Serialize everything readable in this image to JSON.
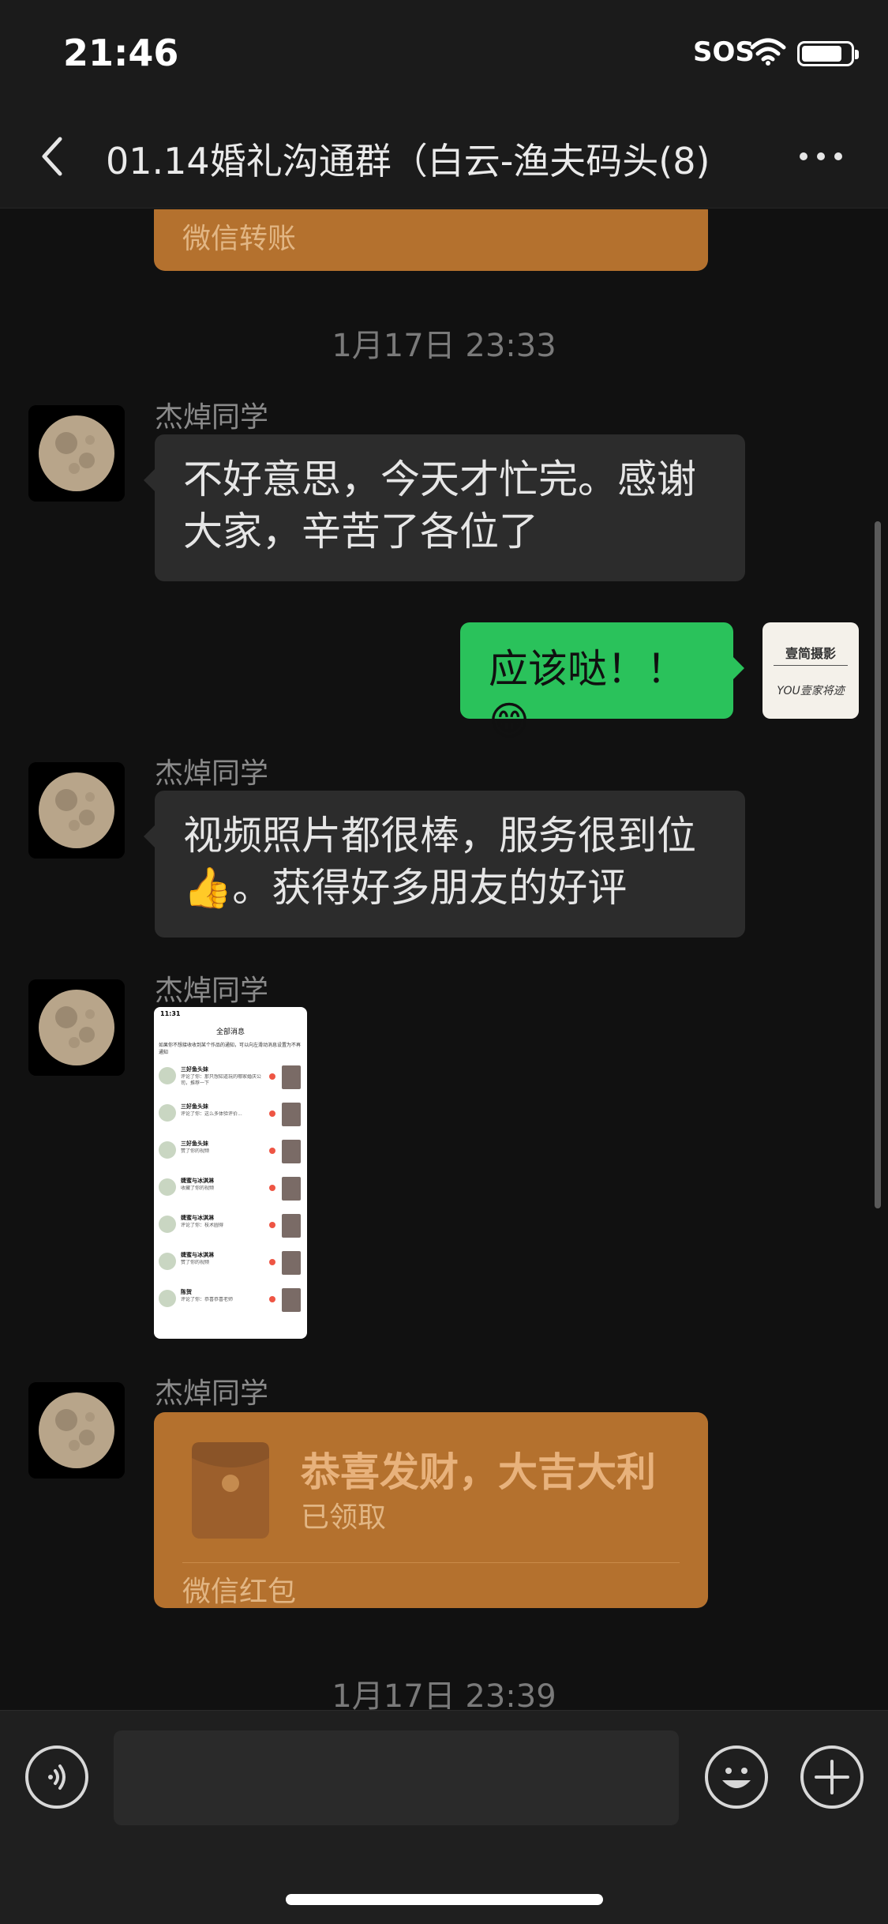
{
  "status_bar": {
    "time": "21:46",
    "sos": "SOS"
  },
  "nav": {
    "title": "01.14婚礼沟通群（白云-渔夫码头(8)"
  },
  "messages": {
    "transfer_card_label": "微信转账",
    "timestamp_1": "1月17日 23:33",
    "msg1": {
      "sender": "杰焯同学",
      "line1": "不好意思，今天才忙完。感谢",
      "line2": "大家，辛苦了各位了"
    },
    "msg2": {
      "text": "应该哒！！😁",
      "avatar_text_top": "壹简摄影",
      "avatar_text_bottom": "YOU壹家将迹"
    },
    "msg3": {
      "sender": "杰焯同学",
      "line1": "视频照片都很棒，服务很到位",
      "line2": "👍。获得好多朋友的好评"
    },
    "msg4": {
      "sender": "杰焯同学"
    },
    "msg5": {
      "sender": "杰焯同学",
      "title": "恭喜发财，大吉大利",
      "status": "已领取",
      "footer": "微信红包"
    },
    "timestamp_2": "1月17日 23:39"
  },
  "thumb": {
    "time": "11:31",
    "header": "全部消息",
    "notice": "如果你不想接收收到某个作品的通知，可以向左滑动消息设置为不再通知",
    "items": [
      {
        "name": "三好鱼头妹",
        "text": "评论了你：那只想知道玩的哪家婚庆公司，推荐一下"
      },
      {
        "name": "三好鱼头妹",
        "text": "评论了你：这么多体验评价..."
      },
      {
        "name": "三好鱼头妹",
        "text": "赞了你的视频"
      },
      {
        "name": "婕蜜与冰淇淋",
        "text": "收藏了你的视频"
      },
      {
        "name": "婕蜜与冰淇淋",
        "text": "评论了你：枝术圆得"
      },
      {
        "name": "婕蜜与冰淇淋",
        "text": "赞了你的视频"
      },
      {
        "name": "陈贺",
        "text": "评论了你：恭喜恭喜老师"
      }
    ]
  },
  "colors": {
    "bubble_green": "#2ac25b",
    "card_orange": "#b4712e",
    "background": "#111111"
  }
}
